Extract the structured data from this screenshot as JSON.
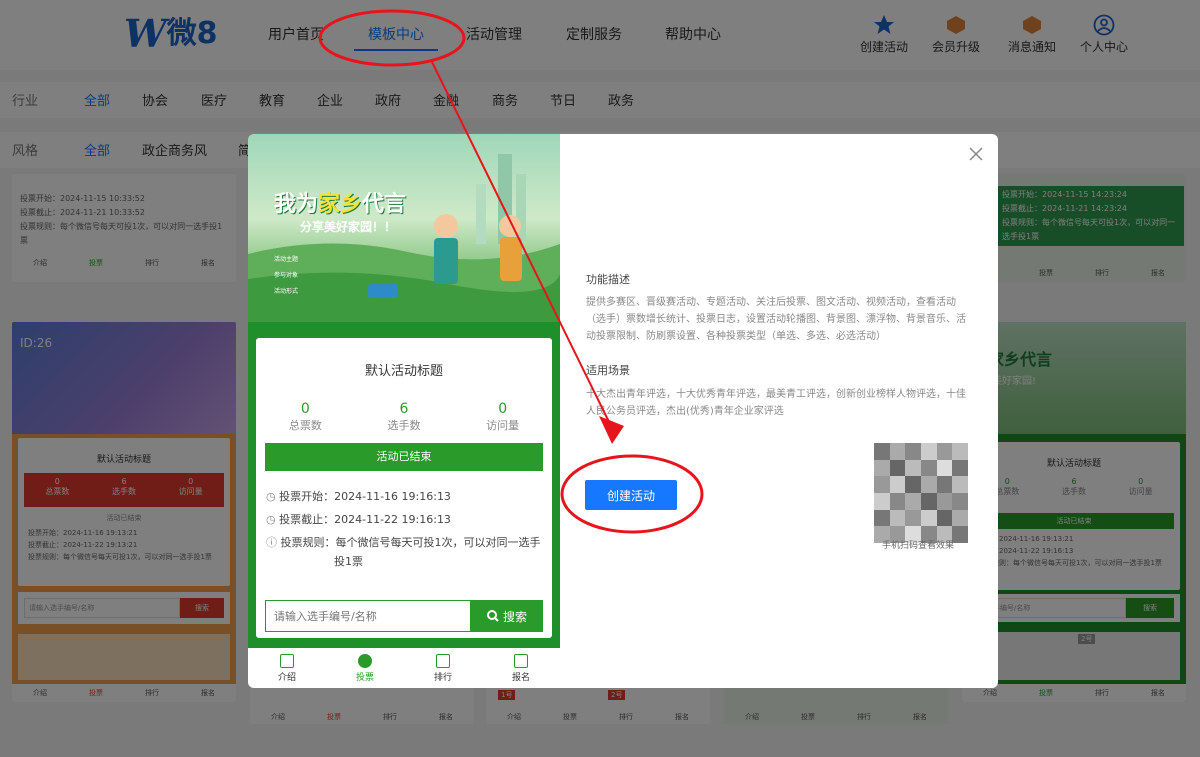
{
  "header": {
    "logo_w": "W",
    "logo_text": "微8",
    "nav": [
      "用户首页",
      "模板中心",
      "活动管理",
      "定制服务",
      "帮助中心"
    ],
    "active_nav": "模板中心",
    "tools": [
      "创建活动",
      "会员升级",
      "消息通知",
      "个人中心"
    ]
  },
  "filters": {
    "industry_label": "行业",
    "industry": [
      "全部",
      "协会",
      "医疗",
      "教育",
      "企业",
      "政府",
      "金融",
      "商务",
      "节日",
      "政务"
    ],
    "style_label": "风格",
    "style": [
      "全部",
      "政企商务风",
      "简"
    ]
  },
  "background_cards": {
    "card1": {
      "start": "投票开始：2024-11-15 10:33:52",
      "end": "投票截止：2024-11-21 10:33:52",
      "rule": "投票规则：每个微信号每天可投1次，可以对同一选手投1票",
      "tabs": [
        "介绍",
        "投票",
        "排行",
        "报名"
      ]
    },
    "card2": {
      "id": "ID:26",
      "title": "默认活动标题",
      "stats": [
        {
          "v": "0",
          "l": "总票数"
        },
        {
          "v": "6",
          "l": "选手数"
        },
        {
          "v": "0",
          "l": "访问量"
        }
      ],
      "status": "活动已结束",
      "start": "投票开始：2024-11-16 19:13:21",
      "end": "投票截止：2024-11-22 19:13:21",
      "rule": "投票规则：每个微信号每天可投1次，可以对同一选手投1票",
      "search_placeholder": "请输入选手编号/名称",
      "search_btn": "搜索",
      "badges": [
        "1号",
        "2号"
      ],
      "tabs": [
        "介绍",
        "投票",
        "排行",
        "报名"
      ]
    },
    "card_right_top": {
      "start": "投票开始：2024-11-15 14:23:24",
      "end": "投票截止：2024-11-21 14:23:24",
      "rule": "投票规则：每个微信号每天可投1次，可以对同一选手投1票",
      "tabs": [
        "介绍",
        "投票",
        "排行",
        "报名"
      ]
    },
    "card_right": {
      "poster_text": "为家乡代言",
      "poster_sub": "分享美好家园!",
      "title": "默认活动标题",
      "stats": [
        {
          "v": "0",
          "l": "总票数"
        },
        {
          "v": "6",
          "l": "选手数"
        },
        {
          "v": "0",
          "l": "访问量"
        }
      ],
      "status": "活动已结束",
      "start": "开始：2024-11-16 19:13:21",
      "end": "截止：2024-11-22 19:16:13",
      "rule": "投票规则：每个微信号每天可投1次，可以对同一选手投1票",
      "search_placeholder": "入选手编号/名称",
      "search_btn": "搜索",
      "badge": "2号",
      "tabs": [
        "介绍",
        "投票",
        "排行",
        "报名"
      ]
    },
    "bottom_badges": [
      "1号",
      "2号"
    ],
    "bottom_tabs": [
      "介绍",
      "投票",
      "排行",
      "报名"
    ]
  },
  "modal": {
    "poster": {
      "headline_a": "我为",
      "headline_b": "家乡",
      "headline_c": "代言",
      "subline": "分享美好家园！！",
      "small_lines": [
        "活动主题",
        "参与对象",
        "活动形式"
      ]
    },
    "card": {
      "title": "默认活动标题",
      "stats": [
        {
          "v": "0",
          "l": "总票数"
        },
        {
          "v": "6",
          "l": "选手数"
        },
        {
          "v": "0",
          "l": "访问量"
        }
      ],
      "status": "活动已结束",
      "start": "投票开始：2024-11-16 19:16:13",
      "end": "投票截止：2024-11-22 19:16:13",
      "rule_a": "投票规则：每个微信号每天可投1次，可以对同一选手",
      "rule_b": "投1票",
      "search_placeholder": "请输入选手编号/名称",
      "search_btn": "搜索"
    },
    "tabs": [
      "介绍",
      "投票",
      "排行",
      "报名"
    ],
    "feature_title": "功能描述",
    "feature_text": "提供多赛区、晋级赛活动、专题活动、关注后投票、图文活动、视频活动，查看活动（选手）票数增长统计、投票日志，设置活动轮播图、背景图、漂浮物、背景音乐、活动投票限制、防刷票设置、各种投票类型（单选、多选、必选活动）",
    "scene_title": "适用场景",
    "scene_text": "十大杰出青年评选，十大优秀青年评选，最美青工评选，创新创业榜样人物评选，十佳人民公务员评选，杰出(优秀)青年企业家评选",
    "create_button": "创建活动",
    "qr_caption": "手机扫码查看效果"
  },
  "colors": {
    "accent": "#1677ff",
    "green": "#2a9a2a",
    "red": "#e33b2e",
    "annotation": "#e8141c"
  }
}
